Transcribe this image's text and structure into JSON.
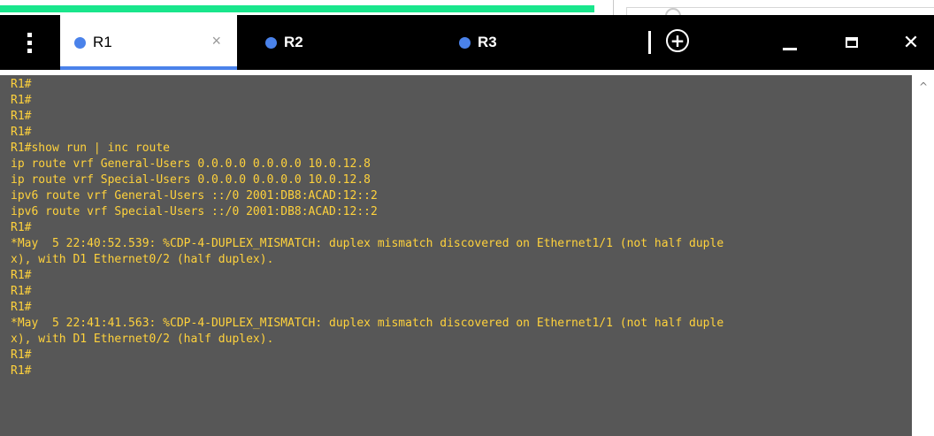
{
  "tabs": [
    {
      "label": "R1",
      "active": true,
      "close_glyph": "×"
    },
    {
      "label": "R2",
      "active": false
    },
    {
      "label": "R3",
      "active": false
    }
  ],
  "toolbar": {
    "new_tab_glyph": "+",
    "close_glyph": "✕"
  },
  "icons": {
    "menu": "vertical-dots-icon",
    "new_tab": "plus-circle-icon",
    "minimize": "minimize-icon",
    "maximize": "maximize-icon",
    "close": "close-icon",
    "scroll_up": "chevron-up-icon"
  },
  "colors": {
    "terminal_bg": "#575757",
    "terminal_text": "#ffd23c",
    "tab_dot": "#4a82ea",
    "accent_green": "#19e68c"
  },
  "terminal": {
    "lines": [
      "R1#",
      "R1#",
      "R1#",
      "R1#",
      "R1#show run | inc route",
      "ip route vrf General-Users 0.0.0.0 0.0.0.0 10.0.12.8",
      "ip route vrf Special-Users 0.0.0.0 0.0.0.0 10.0.12.8",
      "ipv6 route vrf General-Users ::/0 2001:DB8:ACAD:12::2",
      "ipv6 route vrf Special-Users ::/0 2001:DB8:ACAD:12::2",
      "R1#",
      "*May  5 22:40:52.539: %CDP-4-DUPLEX_MISMATCH: duplex mismatch discovered on Ethernet1/1 (not half duple",
      "x), with D1 Ethernet0/2 (half duplex).",
      "R1#",
      "R1#",
      "R1#",
      "*May  5 22:41:41.563: %CDP-4-DUPLEX_MISMATCH: duplex mismatch discovered on Ethernet1/1 (not half duple",
      "x), with D1 Ethernet0/2 (half duplex).",
      "R1#",
      "R1#"
    ]
  },
  "scrollbar": {
    "up_glyph": "^"
  }
}
